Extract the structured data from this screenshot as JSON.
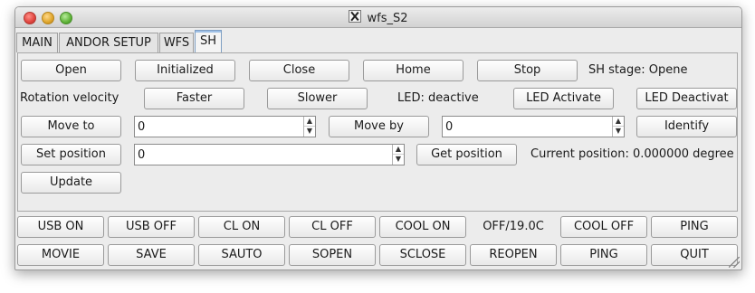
{
  "window": {
    "title": "wfs_S2"
  },
  "tabs": [
    {
      "label": "MAIN",
      "active": false
    },
    {
      "label": "ANDOR SETUP",
      "active": false
    },
    {
      "label": "WFS",
      "active": false
    },
    {
      "label": "SH",
      "active": true
    }
  ],
  "sh": {
    "open_label": "Open",
    "initialized_label": "Initialized",
    "close_label": "Close",
    "home_label": "Home",
    "stop_label": "Stop",
    "stage_status": "SH stage: Opene",
    "rotation_velocity_label": "Rotation velocity",
    "faster_label": "Faster",
    "slower_label": "Slower",
    "led_status": "LED: deactive",
    "led_activate_label": "LED Activate",
    "led_deactivate_label": "LED Deactivat",
    "move_to_label": "Move to",
    "move_to_value": "0",
    "move_by_label": "Move by",
    "move_by_value": "0",
    "identify_label": "Identify",
    "set_position_label": "Set position",
    "set_position_value": "0",
    "get_position_label": "Get position",
    "current_position": "Current position: 0.000000 degree",
    "update_label": "Update"
  },
  "bottom": {
    "row1": {
      "usb_on": "USB ON",
      "usb_off": "USB OFF",
      "cl_on": "CL ON",
      "cl_off": "CL OFF",
      "cool_on": "COOL ON",
      "cool_status": "OFF/19.0C",
      "cool_off": "COOL OFF",
      "ping": "PING"
    },
    "row2": {
      "movie": "MOVIE",
      "save": "SAVE",
      "sauto": "SAUTO",
      "sopen": "SOPEN",
      "sclose": "SCLOSE",
      "reopen": "REOPEN",
      "ping": "PING",
      "quit": "QUIT"
    }
  }
}
